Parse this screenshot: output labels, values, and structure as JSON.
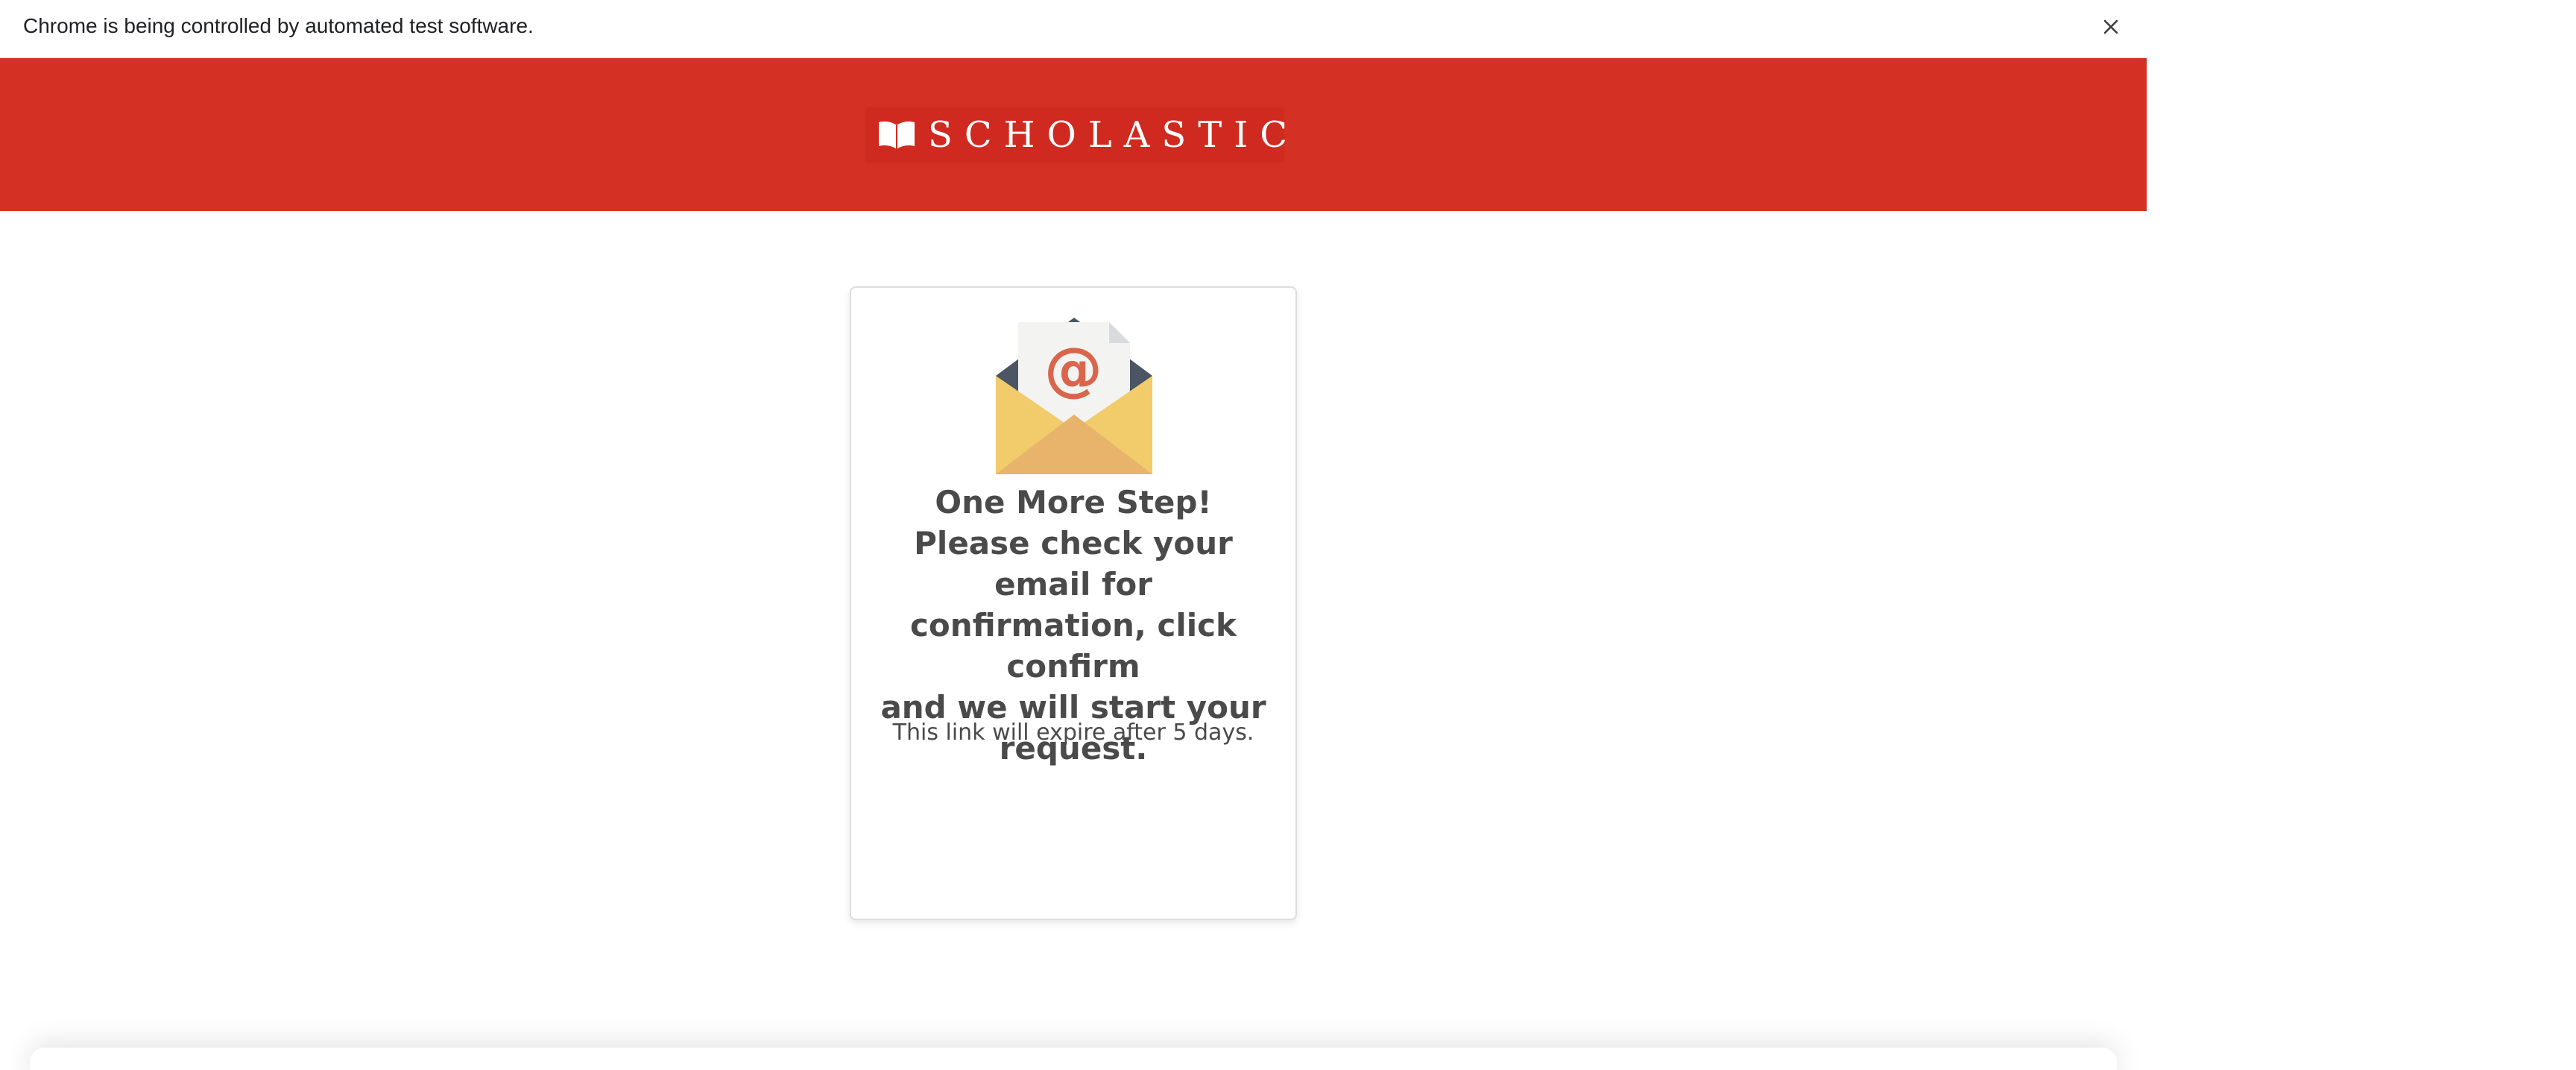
{
  "infobar": {
    "message": "Chrome is being controlled by automated test software.",
    "close_icon": "close-icon"
  },
  "header": {
    "brand_icon": "open-book-icon",
    "brand_name": "SCHOLASTIC",
    "background_color": "#d53024"
  },
  "card": {
    "icon": "envelope-email-icon",
    "heading_lines": [
      "One More Step!",
      "Please check your email for",
      "confirmation, click confirm",
      "and we will start your",
      "request."
    ],
    "note": "This link will expire after 5 days."
  },
  "colors": {
    "text": "#4a4a4a",
    "accent": "#d53024",
    "envelope_front": "#f2cb6b",
    "envelope_inner": "#e8b36a",
    "letter": "#f3f3f1",
    "at_sign": "#d9664c"
  }
}
